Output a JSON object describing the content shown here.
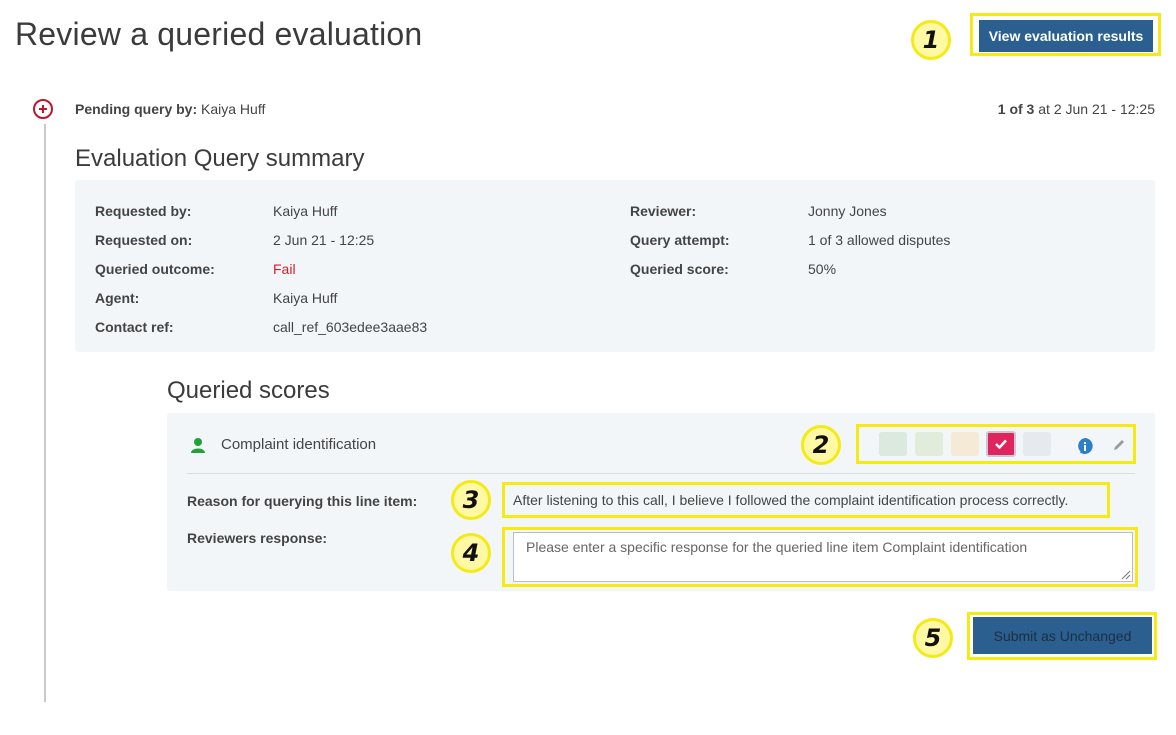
{
  "page": {
    "title": "Review a queried evaluation"
  },
  "actions": {
    "view_results": "View evaluation results",
    "submit": "Submit as Unchanged"
  },
  "callouts": [
    "1",
    "2",
    "3",
    "4",
    "5"
  ],
  "query": {
    "pending_label": "Pending query by:",
    "pending_name": "Kaiya Huff",
    "position": "1 of 3",
    "at_label": "at",
    "timestamp": "2 Jun 21 - 12:25"
  },
  "summary": {
    "heading": "Evaluation Query summary",
    "left": [
      {
        "label": "Requested by:",
        "value": "Kaiya Huff"
      },
      {
        "label": "Requested on:",
        "value": "2 Jun 21 - 12:25"
      },
      {
        "label": "Queried outcome:",
        "value": "Fail"
      },
      {
        "label": "Agent:",
        "value": "Kaiya Huff"
      },
      {
        "label": "Contact ref:",
        "value": "call_ref_603edee3aae83"
      }
    ],
    "right": [
      {
        "label": "Reviewer:",
        "value": "Jonny Jones"
      },
      {
        "label": "Query attempt:",
        "value": "1 of 3 allowed disputes"
      },
      {
        "label": "Queried score:",
        "value": "50%"
      }
    ]
  },
  "scores": {
    "heading": "Queried scores",
    "item_name": "Complaint identification",
    "reason_label": "Reason for querying this line item:",
    "reason_text": "After listening to this call, I believe I followed the complaint identification process correctly.",
    "response_label": "Reviewers response:",
    "response_placeholder": "Please enter a specific response for the queried line item Complaint identification"
  },
  "colors": {
    "primary": "#2a5f8f",
    "highlight": "#f5ea14",
    "fail": "#d0202f",
    "selected_option": "#e0245e"
  }
}
